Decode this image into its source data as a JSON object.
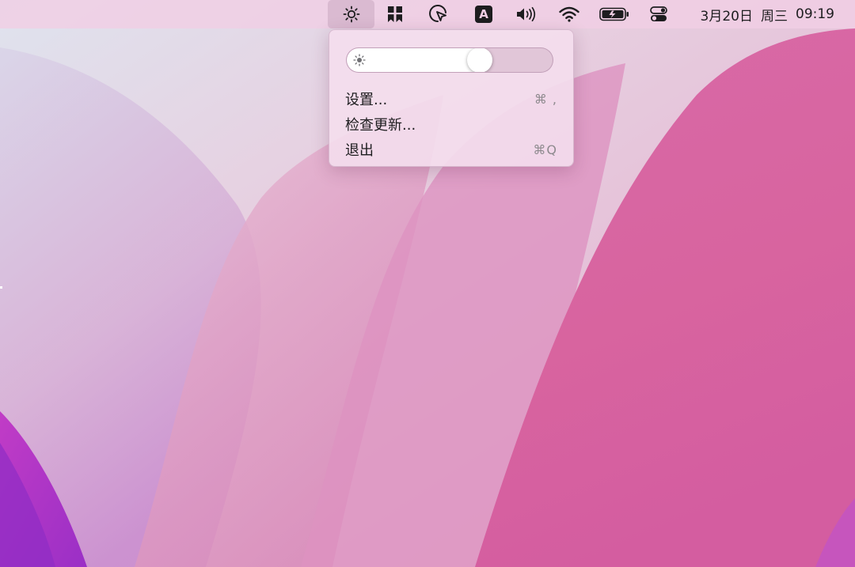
{
  "menubar": {
    "clock": {
      "date": "3月20日",
      "weekday": "周三",
      "time": "09:19"
    },
    "status_icons": [
      {
        "name": "brightness-icon",
        "active": true
      },
      {
        "name": "bookmark-app-icon",
        "active": false
      },
      {
        "name": "screen-capture-icon",
        "active": false
      },
      {
        "name": "input-source-icon",
        "text": "A",
        "active": false
      },
      {
        "name": "volume-icon",
        "active": false
      },
      {
        "name": "wifi-icon",
        "active": false
      },
      {
        "name": "battery-icon",
        "active": false
      },
      {
        "name": "control-center-icon",
        "active": false
      }
    ]
  },
  "brightness_menu": {
    "slider": {
      "icon": "sun-icon",
      "value": 0.66
    },
    "items": [
      {
        "label": "设置...",
        "shortcut": "⌘ ,"
      },
      {
        "label": "检查更新...",
        "shortcut": ""
      },
      {
        "label": "退出",
        "shortcut": "⌘Q"
      }
    ]
  },
  "colors": {
    "wallpaper_pink": "#d866a6",
    "wallpaper_light": "#e9c7dc",
    "wallpaper_purple": "#b23ec7",
    "menubar": "#f0cee4",
    "menu_bg": "#f4deed"
  }
}
